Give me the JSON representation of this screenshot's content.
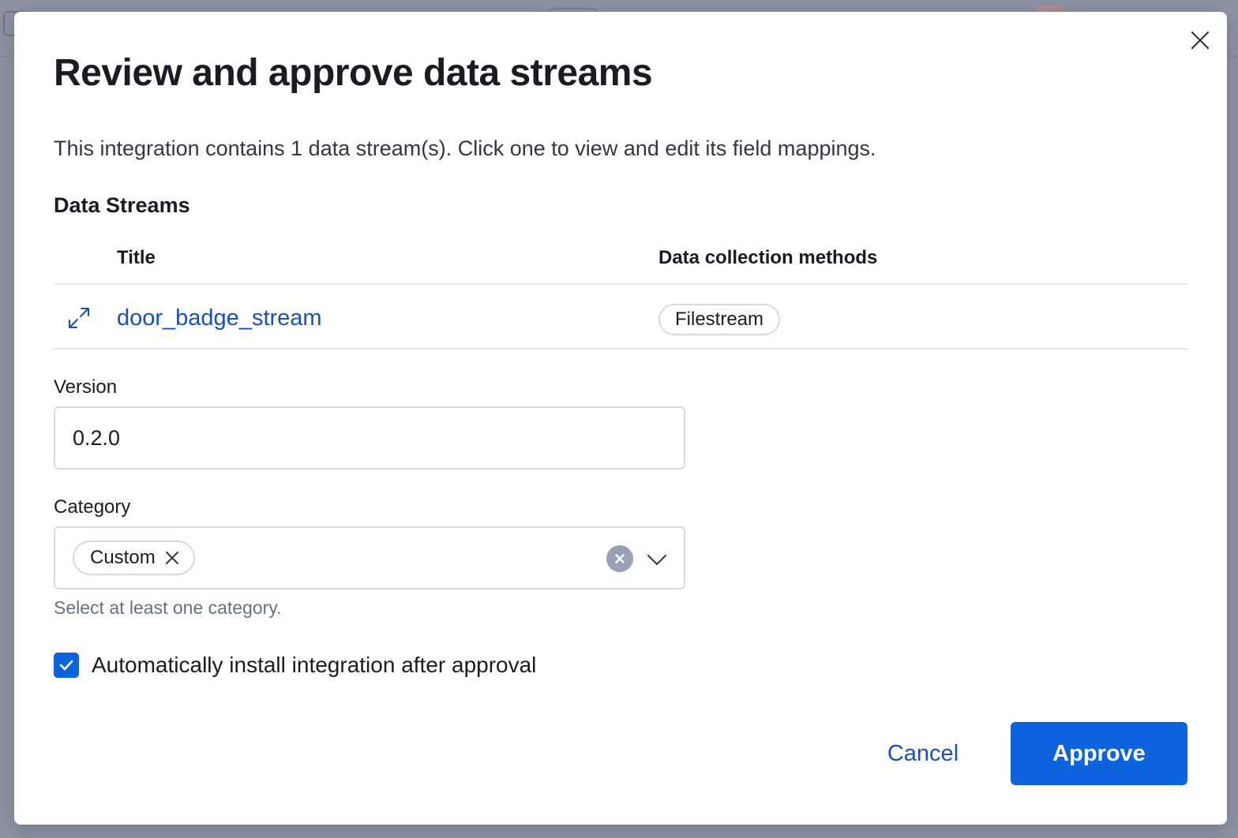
{
  "modal": {
    "title": "Review and approve data streams",
    "description": "This integration contains 1 data stream(s). Click one to view and edit its field mappings.",
    "section_title": "Data Streams",
    "close_icon": "close-icon"
  },
  "table": {
    "columns": [
      "Title",
      "Data collection methods"
    ],
    "rows": [
      {
        "title": "door_badge_stream",
        "methods": [
          "Filestream"
        ],
        "expand_icon": "expand-icon"
      }
    ]
  },
  "version": {
    "label": "Version",
    "value": "0.2.0"
  },
  "category": {
    "label": "Category",
    "selected": [
      "Custom"
    ],
    "help_text": "Select at least one category.",
    "icons": [
      "cross-icon",
      "clear-icon",
      "chevron-down-icon"
    ]
  },
  "auto_install": {
    "label": "Automatically install integration after approval",
    "checked": true
  },
  "footer": {
    "cancel_label": "Cancel",
    "approve_label": "Approve"
  },
  "colors": {
    "primary": "#0b64dd",
    "link": "#1750ba",
    "border": "#d3dae6",
    "overlay": "#8b93a3"
  }
}
